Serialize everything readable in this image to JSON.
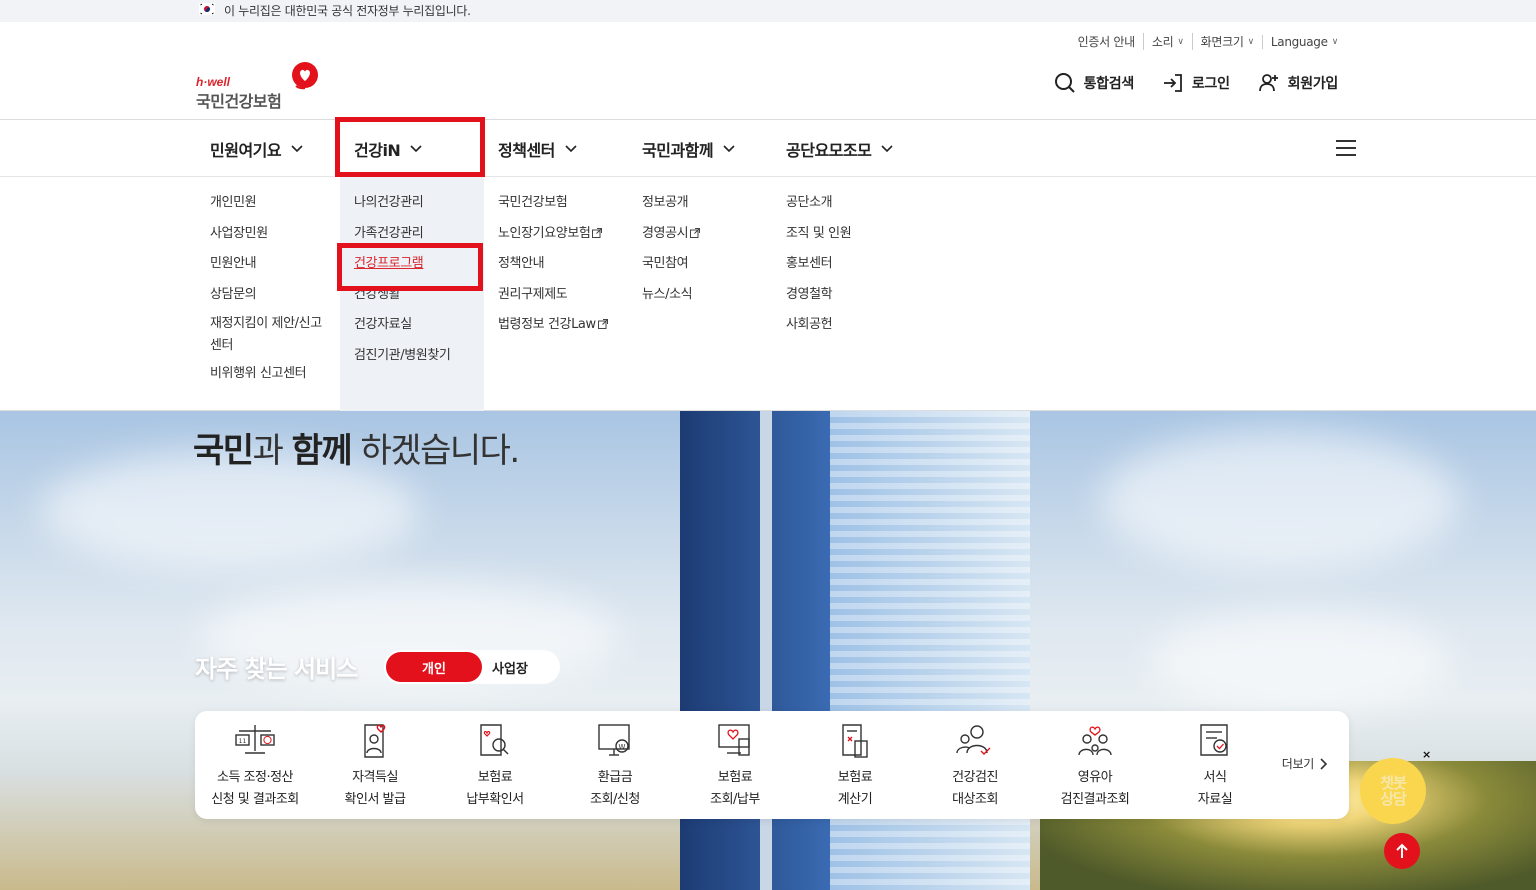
{
  "gov_banner": {
    "text": "이 누리집은 대한민국 공식 전자정부 누리집입니다."
  },
  "utility": {
    "cert": "인증서 안내",
    "sound": "소리",
    "screen_size": "화면크기",
    "language": "Language"
  },
  "logo": {
    "tagline": "h·well",
    "name": "국민건강보험"
  },
  "actions": {
    "search": "통합검색",
    "login": "로그인",
    "signup": "회원가입"
  },
  "gnb": {
    "menus": [
      "민원여기요",
      "건강iN",
      "정책센터",
      "국민과함께",
      "공단요모조모"
    ],
    "active_index": 1
  },
  "dropdown": {
    "col1": [
      "개인민원",
      "사업장민원",
      "민원안내",
      "상담문의",
      "재정지킴이 제안/신고센터",
      "비위행위 신고센터"
    ],
    "col2": [
      "나의건강관리",
      "가족건강관리",
      "건강프로그램",
      "건강생활",
      "건강자료실",
      "검진기관/병원찾기"
    ],
    "col2_active": "건강프로그램",
    "col3": [
      "국민건강보험",
      "노인장기요양보험",
      "정책안내",
      "권리구제제도",
      "법령정보 건강Law"
    ],
    "col4": [
      "정보공개",
      "경영공시",
      "국민참여",
      "뉴스/소식"
    ],
    "col5": [
      "공단소개",
      "조직 및 인원",
      "홍보센터",
      "경영철학",
      "사회공헌"
    ]
  },
  "hero": {
    "line_strong1": "국민",
    "line_mid1": "과 ",
    "line_strong2": "함께",
    "line_rest": " 하겠습니다."
  },
  "services": {
    "heading": "자주 찾는 서비스",
    "toggle_on": "개인",
    "toggle_off": "사업장",
    "items": [
      {
        "l1": "소득 조정·정산",
        "l2": "신청 및 결과조회",
        "icon": "scale-icon"
      },
      {
        "l1": "자격득실",
        "l2": "확인서 발급",
        "icon": "heart-document-icon"
      },
      {
        "l1": "보험료",
        "l2": "납부확인서",
        "icon": "search-document-icon"
      },
      {
        "l1": "환급금",
        "l2": "조회/신청",
        "icon": "monitor-won-icon"
      },
      {
        "l1": "보험료",
        "l2": "조회/납부",
        "icon": "monitor-heart-icon"
      },
      {
        "l1": "보험료",
        "l2": "계산기",
        "icon": "calculator-document-icon"
      },
      {
        "l1": "건강검진",
        "l2": "대상조회",
        "icon": "people-check-icon"
      },
      {
        "l1": "영유아",
        "l2": "검진결과조회",
        "icon": "family-heart-icon"
      },
      {
        "l1": "서식",
        "l2": "자료실",
        "icon": "form-document-icon"
      }
    ],
    "more": "더보기"
  },
  "chatbot": {
    "line1": "챗봇",
    "line2": "상담",
    "close": "×"
  },
  "colors": {
    "brand_red": "#e3111b",
    "chatbot_yellow": "#f9d64e"
  }
}
